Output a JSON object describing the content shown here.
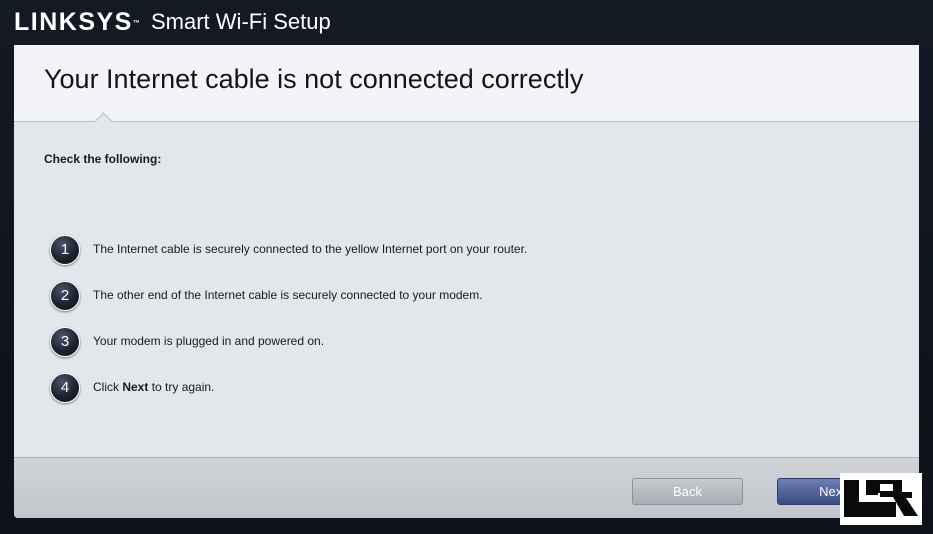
{
  "app": {
    "brand": "LINKSYS",
    "brand_mark": "™",
    "product": "Smart Wi-Fi Setup"
  },
  "dialog": {
    "title": "Your Internet cable is not connected correctly",
    "heading": "Check the following:",
    "steps": [
      {
        "number": "1",
        "text": "The Internet cable is securely connected to the yellow Internet port on your router."
      },
      {
        "number": "2",
        "text": "The other end of the Internet cable is securely connected to your modem."
      },
      {
        "number": "3",
        "text": "Your modem is plugged in and powered on."
      },
      {
        "number": "4",
        "text_prefix": "Click ",
        "text_bold": "Next",
        "text_suffix": " to try again."
      }
    ],
    "buttons": {
      "back": "Back",
      "next": "Next"
    }
  },
  "watermark": {
    "name": "legit-reviews-logo",
    "colors": {
      "background": "#ffffff",
      "mark": "#0a0a0a"
    }
  },
  "colors": {
    "app_background": "#141a24",
    "dialog_body": "#e3e6ea",
    "dialog_header": "#f3f4f7",
    "step_badge": "#1c2330",
    "back_button": "#b4b8be",
    "next_button": "#4a5a94"
  }
}
